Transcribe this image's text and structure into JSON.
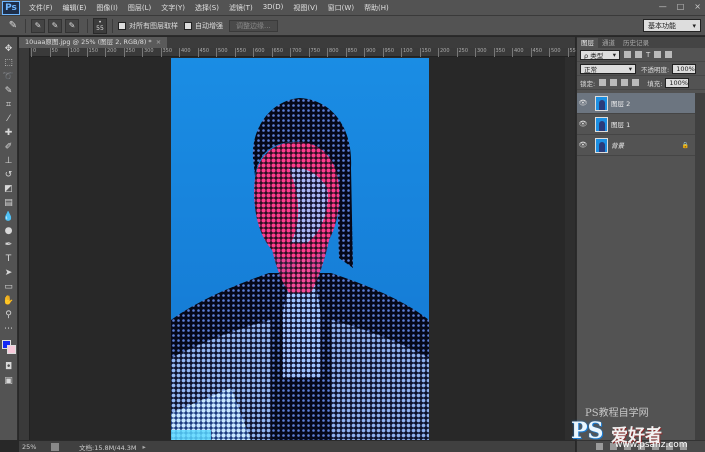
{
  "app": {
    "logo": "Ps",
    "menu": [
      "文件(F)",
      "编辑(E)",
      "图像(I)",
      "图层(L)",
      "文字(Y)",
      "选择(S)",
      "滤镜(T)",
      "3D(D)",
      "视图(V)",
      "窗口(W)",
      "帮助(H)"
    ],
    "window_controls": [
      "—",
      "□",
      "×"
    ]
  },
  "options": {
    "brush_size": "55",
    "sample_all_layers": "对所有图层取样",
    "auto_enhance": "自动增强",
    "refine_edge": "调整边缘...",
    "workspace": "基本功能"
  },
  "document": {
    "tab_title": "10uaa原图.jpg @ 25% (图层 2, RGB/8) *",
    "tab_close": "×",
    "ruler_ticks": [
      "0",
      "50",
      "100",
      "150",
      "200",
      "250",
      "300",
      "350",
      "400",
      "450",
      "500",
      "550",
      "600",
      "650",
      "700",
      "750",
      "800",
      "850",
      "900",
      "950",
      "100",
      "150",
      "200",
      "250",
      "300",
      "350",
      "400",
      "450",
      "500",
      "550"
    ]
  },
  "status": {
    "zoom": "25%",
    "doc_size": "文档:15.8M/44.3M"
  },
  "panel": {
    "tabs": [
      "图层",
      "通道",
      "历史记录"
    ],
    "kind_filter": "ρ 类型",
    "blend_mode": "正常",
    "opacity_label": "不透明度:",
    "opacity_value": "100%",
    "lock_label": "锁定:",
    "fill_label": "填充:",
    "fill_value": "100%",
    "layers": [
      {
        "name": "图层 2",
        "selected": true,
        "italic": false,
        "locked": false
      },
      {
        "name": "图层 1",
        "selected": false,
        "italic": false,
        "locked": false
      },
      {
        "name": "背景",
        "selected": false,
        "italic": true,
        "locked": true
      }
    ],
    "lock_icon": "🔒"
  },
  "watermark": {
    "top": "PS教程自学网",
    "ps": "PS",
    "name": "爱好者",
    "url": "www.psahz.com"
  },
  "colors": {
    "foreground": "#1428f5",
    "background": "#f6c9d9",
    "canvas_bg": "#1b8fe3"
  }
}
